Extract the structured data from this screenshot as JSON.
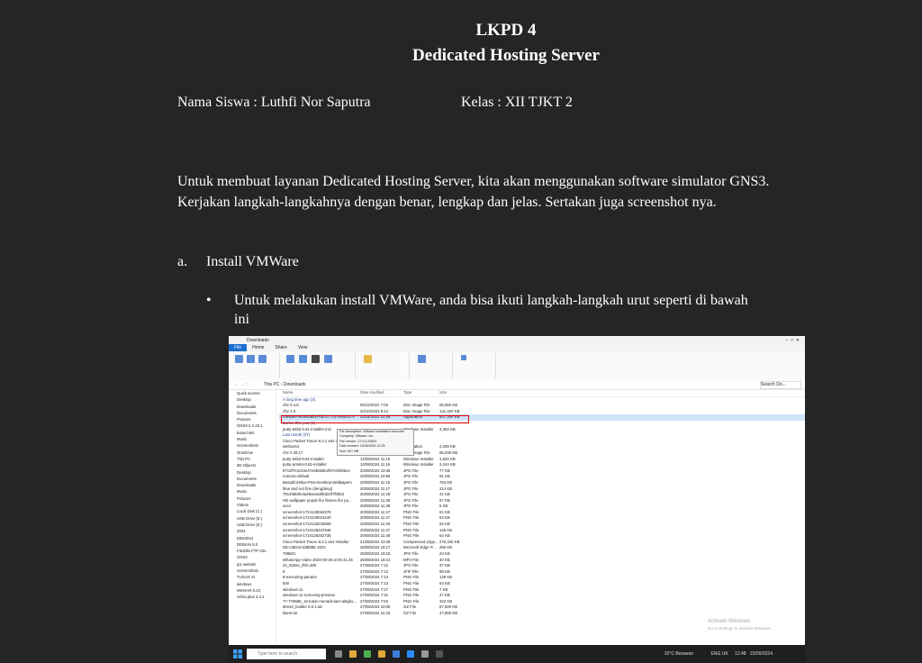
{
  "doc": {
    "title1": "LKPD 4",
    "title2": "Dedicated Hosting Server",
    "name_line": "Nama Siswa : Luthfi Nor Saputra",
    "class_line": "Kelas : XII TJKT 2",
    "paragraph": "Untuk membuat layanan Dedicated Hosting Server, kita akan menggunakan software simulator GNS3. Kerjakan langkah-langkahnya dengan benar, lengkap dan jelas. Sertakan juga screenshot nya.",
    "item_a_marker": "a.",
    "item_a_text": "Install VMWare",
    "bullet_marker": "•",
    "bullet_text": "Untuk melakukan install VMWare, anda bisa ikuti langkah-langkah urut seperti di bawah ini"
  },
  "screenshot": {
    "window_title": "Downloads",
    "tabs": [
      "File",
      "Home",
      "Share",
      "View"
    ],
    "address": "This PC › Downloads",
    "search_placeholder": "Search Do...",
    "nav_items": [
      "Quick access",
      "Desktop",
      "Downloads",
      "Documents",
      "Pictures",
      "GNS3-2.2.40.1",
      "kulas.html",
      "Music",
      "Screenshots",
      "OneDrive",
      "This PC",
      "3D Objects",
      "Desktop",
      "Documents",
      "Downloads",
      "Music",
      "Pictures",
      "Videos",
      "Local Disk (C:)",
      "USB Drive (E:)",
      "USB Drive (E:)",
      "2024",
      "EBS4024",
      "DEBIAN 8.0",
      "FileZilla FTP Clie",
      "GNS3",
      "ip1 website",
      "Screenshots",
      "TUGAS XI",
      "windows",
      "WinRAR 6.23",
      "zebra plus 4.4.2"
    ],
    "headers": [
      "Name",
      "Date modified",
      "Type",
      "Size"
    ],
    "rows": [
      {
        "group": "A long time ago (3)"
      },
      {
        "name": "cfsr 0.4.8",
        "date": "06/12/2021 7:03",
        "type": "Disc Image File",
        "size": "65,050 KB"
      },
      {
        "name": "cfsr 1.8",
        "date": "20/10/2023 9:44",
        "type": "Disc Image File",
        "size": "131,320 KB"
      },
      {
        "name": "VMware-workstation-full-17.0.0-20800274",
        "date": "22/11/2022 12:25",
        "type": "Application",
        "size": "607,344 KB"
      },
      {
        "group": "Earlier this year (1)"
      },
      {
        "name": "putty-64bit-0.81-installer.msi",
        "date": "",
        "type": "Windows Installer",
        "size": "3,392 KB"
      },
      {
        "group": "Last month (37)"
      },
      {
        "name": "Cisco Packet Tracer 8.2.1 x64 Installer",
        "date": "",
        "type": "",
        "size": ""
      },
      {
        "name": "winbox64",
        "date": "05/08/2024 18:04",
        "type": "Application",
        "size": "2,208 KB"
      },
      {
        "name": "cfsr 0.48.17",
        "date": "06/08/2024 9:33",
        "type": "Disc Image File",
        "size": "65,049 KB"
      },
      {
        "name": "putty-64bit-0.81-installer",
        "date": "12/08/2024 11:15",
        "type": "Windows Installer",
        "size": "3,620 KB"
      },
      {
        "name": "putty-arm64-0.81-installer",
        "date": "12/08/2024 11:16",
        "type": "Windows Installer",
        "size": "3,244 KB"
      },
      {
        "name": "9713f7e2c04e47e5b6b8e2f67c0f40be4",
        "date": "20/08/2024 10:46",
        "type": "JPG File",
        "size": "77 KB"
      },
      {
        "name": "macosx-default",
        "date": "20/08/2024 10:56",
        "type": "JPG File",
        "size": "81 KB"
      },
      {
        "name": "Beautiful-Blue-Pine-Desktop-Wallpapers",
        "date": "20/08/2024 11:15",
        "type": "JPG File",
        "size": "763 KB"
      },
      {
        "name": "blue and red fine (dengdeng)",
        "date": "20/08/2024 11:17",
        "type": "JPG File",
        "size": "214 KB"
      },
      {
        "name": "7914fd82fe4a29ae4a3f6d23f7fb9b2",
        "date": "20/08/2024 11:28",
        "type": "JPG File",
        "size": "41 KB"
      },
      {
        "name": "HD wallpaper purple fire flames fire pu...",
        "date": "20/08/2024 11:38",
        "type": "JPG File",
        "size": "87 KB"
      },
      {
        "name": "sce4",
        "date": "20/08/2024 11:38",
        "type": "JPG File",
        "size": "5 KB"
      },
      {
        "name": "screenshot-1724128062278",
        "date": "20/08/2024 11:47",
        "type": "PNG File",
        "size": "61 KB"
      },
      {
        "name": "screenshot-1724128023440",
        "date": "20/08/2024 11:47",
        "type": "PNG File",
        "size": "53 KB"
      },
      {
        "name": "screenshot-1724128215609",
        "date": "20/08/2024 11:46",
        "type": "PNG File",
        "size": "54 KB"
      },
      {
        "name": "screenshot-1724128237946",
        "date": "20/08/2024 11:47",
        "type": "PNG File",
        "size": "146 KB"
      },
      {
        "name": "screenshot-1724128262735",
        "date": "20/08/2024 11:48",
        "type": "PNG File",
        "size": "64 KB"
      },
      {
        "name": "Cisco Packet Tracer 8.2.1 x64 Installer",
        "date": "21/08/2024 13:28",
        "type": "Compressed (zipp...",
        "size": "279,340 KB"
      },
      {
        "name": "DE-CBD4A43B89E 2024",
        "date": "26/08/2024 18:17",
        "type": "Microsoft Edge P...",
        "size": "266 KB"
      },
      {
        "name": "788601",
        "date": "26/08/2024 18:18",
        "type": "JPG File",
        "size": "23 KB"
      },
      {
        "name": "WhatsApp Video 2024-08-26 at 00.41.26",
        "date": "26/08/2024 18:41",
        "type": "MP4 File",
        "size": "40 KB"
      },
      {
        "name": "42_8265c_ifKb.485",
        "date": "27/08/2024 7:12",
        "type": "JPG File",
        "size": "37 KB"
      },
      {
        "name": "8",
        "date": "27/08/2024 7:13",
        "type": "JFIF File",
        "size": "98 KB"
      },
      {
        "name": "8-executing-panden",
        "date": "27/08/2024 7:13",
        "type": "PNG File",
        "size": "148 KB"
      },
      {
        "name": "8x9",
        "date": "27/08/2024 7:23",
        "type": "PNG File",
        "size": "63 KB"
      },
      {
        "name": "windows-11",
        "date": "27/08/2024 7:27",
        "type": "PNG File",
        "size": "7 KB"
      },
      {
        "name": "windows-11-removing-preview",
        "date": "27/08/2024 7:31",
        "type": "PNG File",
        "size": "47 KB"
      },
      {
        "name": "77-778685_15-Katie-menarik-laer-aktgku...",
        "date": "27/08/2024 7:53",
        "type": "PNG File",
        "size": "322 KB"
      },
      {
        "name": "dtmsd_builder 8.0.1.tar",
        "date": "27/08/2024 10:08",
        "type": "GZ File",
        "size": "67,929 KB"
      },
      {
        "name": "latest.tar",
        "date": "27/08/2024 11:23",
        "type": "GZ File",
        "size": "47,860 KB"
      }
    ],
    "tooltip_lines": [
      "File description: VMware installation launcher",
      "Company: VMware, Inc.",
      "File version: 17.0.0.20800",
      "Date created: 22/08/2024 12:25",
      "Size: 607 MB"
    ],
    "watermark_1": "Activate Windows",
    "watermark_2": "Go to Settings to activate Windows.",
    "taskbar_search": "Type here to search",
    "weather": "32°C Berawan",
    "clock_time": "12:48",
    "clock_date": "23/09/2024",
    "lang": "ENG UK",
    "colors": {
      "accent": "#1a6fd0",
      "selection_box": "#e00000",
      "taskbar": "#1f1f1f"
    }
  }
}
